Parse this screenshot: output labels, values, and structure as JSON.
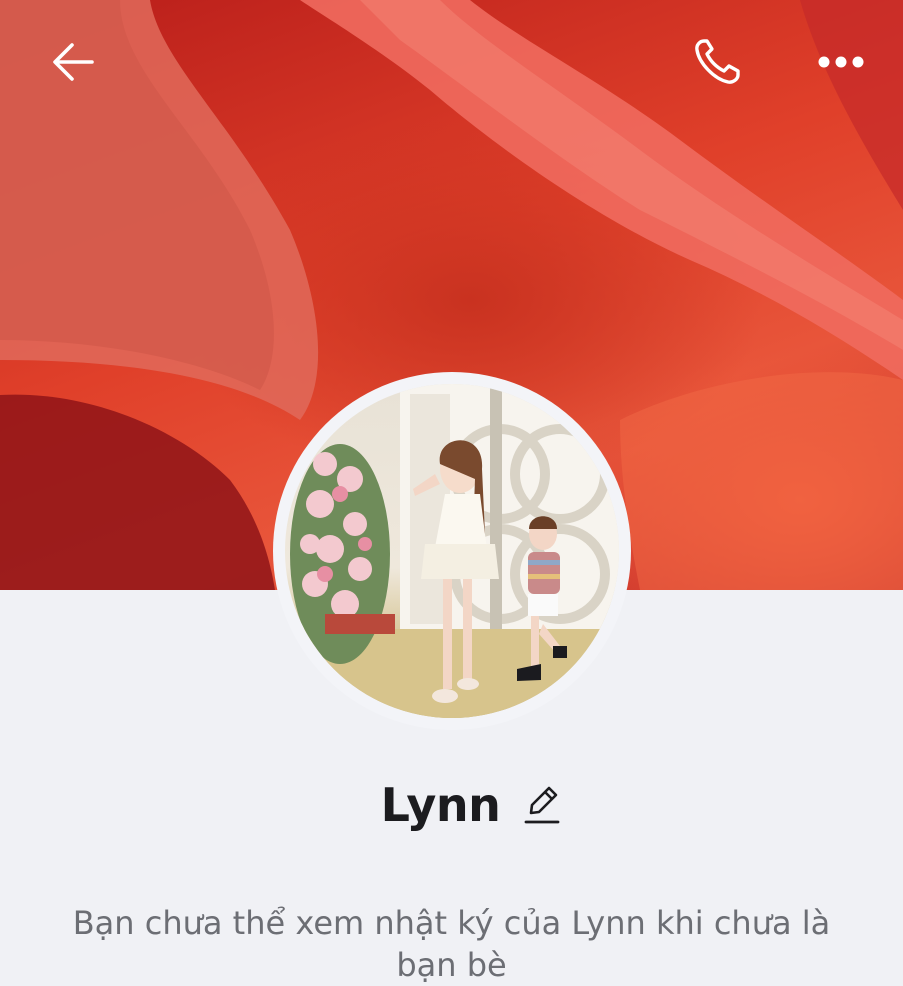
{
  "header": {
    "back_icon": "arrow-left-icon",
    "call_icon": "phone-icon",
    "more_icon": "more-horizontal-icon"
  },
  "profile": {
    "name": "Lynn",
    "edit_icon": "pencil-icon"
  },
  "notice": {
    "text": "Bạn chưa thể xem nhật ký của Lynn khi chưa là bạn bè"
  },
  "colors": {
    "page_background": "#f0f1f5",
    "name_text": "#1c1c1f",
    "notice_text": "#6c6e74",
    "cover_accent": "#d9352a"
  }
}
